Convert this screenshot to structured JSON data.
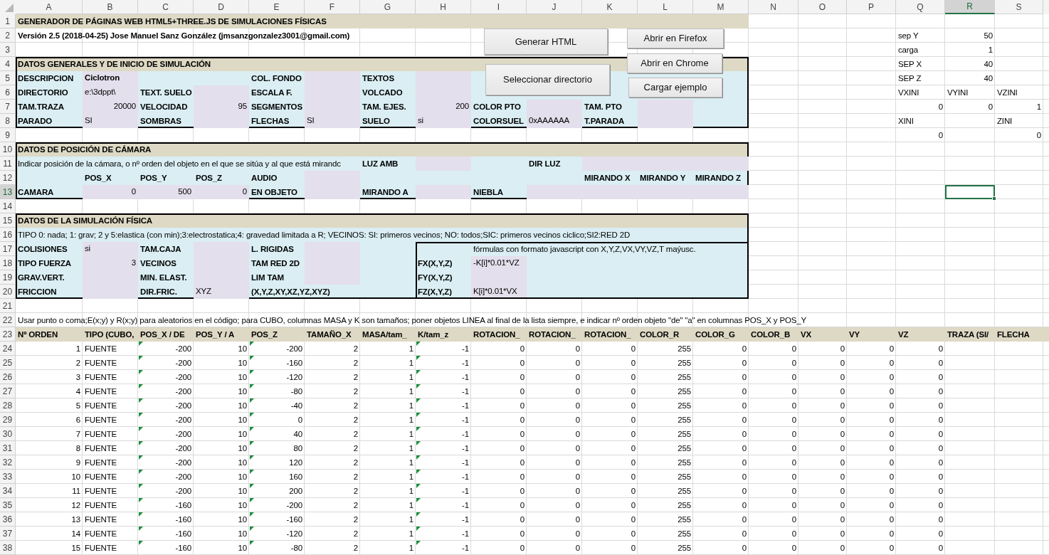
{
  "columns": [
    {
      "label": "A",
      "selected": false
    },
    {
      "label": "B",
      "selected": false
    },
    {
      "label": "C",
      "selected": false
    },
    {
      "label": "D",
      "selected": false
    },
    {
      "label": "E",
      "selected": false
    },
    {
      "label": "F",
      "selected": false
    },
    {
      "label": "G",
      "selected": false
    },
    {
      "label": "H",
      "selected": false
    },
    {
      "label": "I",
      "selected": false
    },
    {
      "label": "J",
      "selected": false
    },
    {
      "label": "K",
      "selected": false
    },
    {
      "label": "L",
      "selected": false
    },
    {
      "label": "M",
      "selected": false
    },
    {
      "label": "N",
      "selected": false
    },
    {
      "label": "O",
      "selected": false
    },
    {
      "label": "P",
      "selected": false
    },
    {
      "label": "Q",
      "selected": false
    },
    {
      "label": "R",
      "selected": true
    },
    {
      "label": "S",
      "selected": false
    }
  ],
  "buttons": [
    "Generar HTML",
    "Abrir en Firefox",
    "Abrir en Chrome",
    "Seleccionar directorio",
    "Cargar ejemplo"
  ],
  "rows": [
    {
      "n": "1",
      "kind": "heading",
      "selected": false,
      "cells": [
        {
          "text": "GENERADOR DE PÁGINAS WEB HTML5+THREE.JS DE SIMULACIONES FÍSICAS",
          "kind": "title",
          "input": false
        }
      ]
    },
    {
      "n": "2",
      "kind": "plain",
      "selected": false,
      "cells": [
        {
          "text": "Versión 2.5 (2018-04-25) Jose Manuel Sanz González (jmsanzgonzalez3001@gmail.com)",
          "kind": "label",
          "input": false
        },
        null,
        null,
        null,
        null,
        null,
        null,
        null,
        null,
        null,
        null,
        null,
        null,
        null,
        null,
        null,
        {
          "text": "sep Y",
          "kind": "text",
          "input": false
        },
        {
          "text": "50",
          "kind": "number",
          "input": false
        }
      ]
    },
    {
      "n": "3",
      "kind": "plain",
      "selected": false,
      "cells": [
        null,
        null,
        null,
        null,
        null,
        null,
        null,
        null,
        null,
        null,
        null,
        null,
        null,
        null,
        null,
        null,
        {
          "text": "carga",
          "kind": "text",
          "input": false
        },
        {
          "text": "1",
          "kind": "number",
          "input": false
        }
      ]
    },
    {
      "n": "4",
      "kind": "section",
      "selected": false,
      "cells": [
        {
          "text": "DATOS GENERALES Y DE INICIO DE SIMULACIÓN",
          "kind": "title",
          "input": false
        },
        null,
        null,
        null,
        null,
        null,
        null,
        null,
        null,
        null,
        null,
        null,
        null,
        null,
        null,
        null,
        {
          "text": "SEP X",
          "kind": "text",
          "input": false
        },
        {
          "text": "40",
          "kind": "number",
          "input": false
        }
      ]
    },
    {
      "n": "5",
      "kind": "panel",
      "selected": false,
      "cells": [
        {
          "text": "DESCRIPCION",
          "kind": "label",
          "input": false
        },
        {
          "text": "Ciclotron",
          "kind": "label",
          "input": true
        },
        null,
        null,
        {
          "text": "COL. FONDO",
          "kind": "label",
          "input": false
        },
        {
          "kind": "blank",
          "input": true
        },
        {
          "text": "TEXTOS",
          "kind": "label",
          "input": false
        },
        {
          "kind": "blank",
          "input": true
        },
        null,
        null,
        null,
        null,
        null,
        null,
        null,
        null,
        {
          "text": "SEP Z",
          "kind": "text",
          "input": false
        },
        {
          "text": "40",
          "kind": "number",
          "input": false
        }
      ]
    },
    {
      "n": "6",
      "kind": "panel",
      "selected": false,
      "cells": [
        {
          "text": "DIRECTORIO",
          "kind": "label",
          "input": false
        },
        {
          "text": "e:\\3dppt\\",
          "kind": "text",
          "input": true
        },
        {
          "text": "TEXT. SUELO",
          "kind": "label",
          "input": false
        },
        {
          "kind": "blank",
          "input": true
        },
        {
          "text": "ESCALA F.",
          "kind": "label",
          "input": false
        },
        {
          "kind": "blank",
          "input": true
        },
        {
          "text": "VOLCADO",
          "kind": "label",
          "input": false
        },
        {
          "kind": "blank",
          "input": true
        },
        null,
        null,
        null,
        null,
        null,
        null,
        null,
        null,
        {
          "text": "VXINI",
          "kind": "text",
          "input": false
        },
        {
          "text": "VYINI",
          "kind": "text",
          "input": false
        },
        {
          "text": "VZINI",
          "kind": "text",
          "input": false
        }
      ]
    },
    {
      "n": "7",
      "kind": "panel",
      "selected": false,
      "cells": [
        {
          "text": "TAM.TRAZA",
          "kind": "label",
          "input": false
        },
        {
          "text": "20000",
          "kind": "number",
          "input": true
        },
        {
          "text": "VELOCIDAD",
          "kind": "label",
          "input": false
        },
        {
          "text": "95",
          "kind": "number",
          "input": true
        },
        {
          "text": "SEGMENTOS",
          "kind": "label",
          "input": false
        },
        {
          "kind": "blank",
          "input": true
        },
        {
          "text": "TAM. EJES.",
          "kind": "label",
          "input": false
        },
        {
          "text": "200",
          "kind": "number",
          "input": true
        },
        {
          "text": "COLOR PTO",
          "kind": "label",
          "input": false
        },
        {
          "kind": "blank",
          "input": true
        },
        {
          "text": "TAM. PTO",
          "kind": "label",
          "input": false
        },
        {
          "kind": "blank",
          "input": true
        },
        null,
        null,
        null,
        null,
        {
          "text": "0",
          "kind": "number",
          "input": false
        },
        {
          "text": "0",
          "kind": "number",
          "input": false
        },
        {
          "text": "1",
          "kind": "number",
          "input": false
        }
      ]
    },
    {
      "n": "8",
      "kind": "panel",
      "selected": false,
      "cells": [
        {
          "text": "PARADO",
          "kind": "label",
          "input": false
        },
        {
          "text": "SI",
          "kind": "text",
          "input": true
        },
        {
          "text": "SOMBRAS",
          "kind": "label",
          "input": false
        },
        {
          "kind": "blank",
          "input": true
        },
        {
          "text": "FLECHAS",
          "kind": "label",
          "input": false
        },
        {
          "text": "SI",
          "kind": "text",
          "input": true
        },
        {
          "text": "SUELO",
          "kind": "label",
          "input": false
        },
        {
          "text": "si",
          "kind": "text",
          "input": true
        },
        {
          "text": "COLORSUEL",
          "kind": "label",
          "input": false
        },
        {
          "text": "0xAAAAAA",
          "kind": "text",
          "input": true
        },
        {
          "text": "T.PARADA",
          "kind": "label",
          "input": false
        },
        {
          "kind": "blank",
          "input": true
        },
        null,
        null,
        null,
        null,
        {
          "text": "XINI",
          "kind": "text",
          "input": false
        },
        null,
        {
          "text": "ZINI",
          "kind": "text",
          "input": false
        }
      ]
    },
    {
      "n": "9",
      "kind": "plain",
      "selected": false,
      "cells": [
        null,
        null,
        null,
        null,
        null,
        null,
        null,
        null,
        null,
        null,
        null,
        null,
        null,
        null,
        null,
        null,
        {
          "text": "0",
          "kind": "number",
          "input": false
        },
        null,
        {
          "text": "0",
          "kind": "number",
          "input": false
        }
      ]
    },
    {
      "n": "10",
      "kind": "section",
      "selected": false,
      "cells": [
        {
          "text": "DATOS DE POSICIÓN DE CÁMARA",
          "kind": "title",
          "input": false
        }
      ]
    },
    {
      "n": "11",
      "kind": "panel",
      "selected": false,
      "cells": [
        {
          "text": "Indicar posición de la cámara, o nº orden del objeto en el que se sitúa y al que está mirandc",
          "kind": "text",
          "input": false
        },
        null,
        null,
        null,
        null,
        null,
        {
          "text": "LUZ AMB",
          "kind": "label",
          "input": false
        },
        {
          "kind": "blank",
          "input": true
        },
        null,
        {
          "text": "DIR LUZ",
          "kind": "label",
          "input": false
        },
        {
          "kind": "blank",
          "input": true
        },
        {
          "kind": "blank",
          "input": true
        },
        {
          "kind": "blank",
          "input": true
        }
      ]
    },
    {
      "n": "12",
      "kind": "panel",
      "selected": false,
      "cells": [
        null,
        {
          "text": "POS_X",
          "kind": "label",
          "input": false
        },
        {
          "text": "POS_Y",
          "kind": "label",
          "input": false
        },
        {
          "text": "POS_Z",
          "kind": "label",
          "input": false
        },
        {
          "text": "AUDIO",
          "kind": "label",
          "input": false
        },
        {
          "kind": "blank",
          "input": true
        },
        null,
        null,
        null,
        null,
        {
          "text": "MIRANDO X",
          "kind": "label",
          "input": false
        },
        {
          "text": "MIRANDO Y",
          "kind": "label",
          "input": false
        },
        {
          "text": "MIRANDO Z",
          "kind": "label",
          "input": false
        }
      ]
    },
    {
      "n": "13",
      "kind": "panel",
      "selected": true,
      "cells": [
        {
          "text": "CAMARA",
          "kind": "label",
          "input": false
        },
        {
          "text": "0",
          "kind": "number",
          "input": true
        },
        {
          "text": "500",
          "kind": "number",
          "input": true
        },
        {
          "text": "0",
          "kind": "number",
          "input": true
        },
        {
          "text": "EN OBJETO",
          "kind": "label",
          "input": false
        },
        {
          "kind": "blank",
          "input": true
        },
        {
          "text": "MIRANDO A",
          "kind": "label",
          "input": false
        },
        {
          "kind": "blank",
          "input": true
        },
        {
          "text": "NIEBLA",
          "kind": "label",
          "input": false
        },
        {
          "kind": "blank",
          "input": true
        },
        {
          "kind": "blank",
          "input": true
        },
        {
          "kind": "blank",
          "input": true
        },
        {
          "kind": "blank",
          "input": true
        }
      ]
    },
    {
      "n": "14",
      "kind": "plain",
      "selected": false
    },
    {
      "n": "15",
      "kind": "section",
      "selected": false,
      "cells": [
        {
          "text": "DATOS DE LA SIMULACIÓN FÍSICA",
          "kind": "title",
          "input": false
        }
      ]
    },
    {
      "n": "16",
      "kind": "panel",
      "selected": false,
      "cells": [
        {
          "text": "TIPO 0: nada; 1: grav; 2 y 5:elastica (con min);3:electrostatica;4: gravedad limitada a R; VECINOS: SI: primeros vecinos; NO: todos;SIC: primeros vecinos ciclico;SI2:RED 2D",
          "kind": "text",
          "input": false
        }
      ]
    },
    {
      "n": "17",
      "kind": "panel",
      "selected": false,
      "formula_box": true,
      "cells": [
        {
          "text": "COLISIONES",
          "kind": "label",
          "input": false
        },
        {
          "text": "si",
          "kind": "text",
          "input": true
        },
        {
          "text": "TAM.CAJA",
          "kind": "label",
          "input": false
        },
        {
          "kind": "blank",
          "input": true
        },
        {
          "text": "L. RIGIDAS",
          "kind": "label",
          "input": false
        },
        {
          "kind": "blank",
          "input": true
        },
        null,
        null,
        {
          "text": "fórmulas con formato javascript con X,Y,Z,VX,VY,VZ,T maýusc.",
          "kind": "text",
          "input": false
        }
      ]
    },
    {
      "n": "18",
      "kind": "panel",
      "selected": false,
      "formula_box": true,
      "cells": [
        {
          "text": "TIPO FUERZA",
          "kind": "label",
          "input": false
        },
        {
          "text": "3",
          "kind": "number",
          "input": true
        },
        {
          "text": "VECINOS",
          "kind": "label",
          "input": false
        },
        {
          "kind": "blank",
          "input": true
        },
        {
          "text": "TAM RED 2D",
          "kind": "label",
          "input": false
        },
        {
          "kind": "blank",
          "input": true
        },
        null,
        {
          "text": "FX(X,Y,Z)",
          "kind": "label",
          "input": false
        },
        {
          "text": "-K[i]*0.01*VZ",
          "kind": "text",
          "input": true
        }
      ]
    },
    {
      "n": "19",
      "kind": "panel",
      "selected": false,
      "formula_box": true,
      "cells": [
        {
          "text": "GRAV.VERT.",
          "kind": "label",
          "input": false
        },
        {
          "kind": "blank",
          "input": true
        },
        {
          "text": "MIN. ELAST.",
          "kind": "label",
          "input": false
        },
        {
          "kind": "blank",
          "input": true
        },
        {
          "text": "LIM TAM",
          "kind": "label",
          "input": false
        },
        {
          "kind": "blank",
          "input": true
        },
        null,
        {
          "text": "FY(X,Y,Z)",
          "kind": "label",
          "input": false
        },
        {
          "kind": "blank",
          "input": true
        }
      ]
    },
    {
      "n": "20",
      "kind": "panel",
      "selected": false,
      "formula_box": true,
      "cells": [
        {
          "text": "FRICCION",
          "kind": "label",
          "input": false
        },
        {
          "kind": "blank",
          "input": true
        },
        {
          "text": "DIR.FRIC.",
          "kind": "label",
          "input": false
        },
        {
          "text": "XYZ",
          "kind": "text",
          "input": true
        },
        {
          "text": "(X,Y,Z,XY,XZ,YZ,XYZ)",
          "kind": "label",
          "input": false
        },
        null,
        null,
        {
          "text": "FZ(X,Y,Z)",
          "kind": "label",
          "input": false
        },
        {
          "text": "K[i]*0.01*VX",
          "kind": "text",
          "input": true
        }
      ]
    },
    {
      "n": "21",
      "kind": "plain",
      "selected": false
    },
    {
      "n": "22",
      "kind": "plain",
      "selected": false,
      "cells": [
        {
          "text": "Usar punto o coma;E(x;y) y R(x;y) para aleatorios en el código; para CUBO, columnas MASA y K son tamaños; poner objetos LINEA al final de la lista siempre, e indicar nº orden objeto \"de\" \"a\" en columnas POS_X y POS_Y",
          "kind": "text",
          "input": false
        }
      ]
    }
  ],
  "table": {
    "n": "23",
    "selected": false,
    "columns": [
      {
        "label": "Nº ORDEN",
        "kind": "number"
      },
      {
        "label": "TIPO (CUBO,",
        "kind": "text"
      },
      {
        "label": "POS_X / DE",
        "kind": "number"
      },
      {
        "label": "POS_Y / A",
        "kind": "number"
      },
      {
        "label": "POS_Z",
        "kind": "number"
      },
      {
        "label": "TAMAÑO_X",
        "kind": "number"
      },
      {
        "label": "MASA/tam_",
        "kind": "number"
      },
      {
        "label": "K/tam_z",
        "kind": "number"
      },
      {
        "label": "ROTACION_",
        "kind": "number"
      },
      {
        "label": "ROTACION_",
        "kind": "number"
      },
      {
        "label": "ROTACION_",
        "kind": "number"
      },
      {
        "label": "COLOR_R",
        "kind": "number"
      },
      {
        "label": "COLOR_G",
        "kind": "number"
      },
      {
        "label": "COLOR_B",
        "kind": "number"
      },
      {
        "label": "VX",
        "kind": "number"
      },
      {
        "label": "VY",
        "kind": "number"
      },
      {
        "label": "VZ",
        "kind": "number"
      },
      {
        "label": "TRAZA (SI/",
        "kind": "text"
      },
      {
        "label": "FLECHA",
        "kind": "text"
      }
    ],
    "rows": [
      {
        "n": "24",
        "selected": false,
        "values": [
          "1",
          "FUENTE",
          "-200",
          "10",
          "-200",
          "2",
          "1",
          "-1",
          "0",
          "0",
          "0",
          "255",
          "0",
          "0",
          "0",
          "0",
          "0"
        ],
        "warn": [
          false,
          false,
          true,
          false,
          true,
          false,
          false,
          true,
          false,
          false,
          false,
          false,
          false,
          false,
          false,
          false,
          false
        ]
      },
      {
        "n": "25",
        "selected": false,
        "values": [
          "2",
          "FUENTE",
          "-200",
          "10",
          "-160",
          "2",
          "1",
          "-1",
          "0",
          "0",
          "0",
          "255",
          "0",
          "0",
          "0",
          "0",
          "0"
        ],
        "warn": [
          false,
          false,
          true,
          false,
          true,
          false,
          false,
          true,
          false,
          false,
          false,
          false,
          false,
          false,
          false,
          false,
          false
        ]
      },
      {
        "n": "26",
        "selected": false,
        "values": [
          "3",
          "FUENTE",
          "-200",
          "10",
          "-120",
          "2",
          "1",
          "-1",
          "0",
          "0",
          "0",
          "255",
          "0",
          "0",
          "0",
          "0",
          "0"
        ],
        "warn": [
          false,
          false,
          true,
          false,
          true,
          false,
          false,
          true,
          false,
          false,
          false,
          false,
          false,
          false,
          false,
          false,
          false
        ]
      },
      {
        "n": "27",
        "selected": false,
        "values": [
          "4",
          "FUENTE",
          "-200",
          "10",
          "-80",
          "2",
          "1",
          "-1",
          "0",
          "0",
          "0",
          "255",
          "0",
          "0",
          "0",
          "0",
          "0"
        ],
        "warn": [
          false,
          false,
          true,
          false,
          true,
          false,
          false,
          true,
          false,
          false,
          false,
          false,
          false,
          false,
          false,
          false,
          false
        ]
      },
      {
        "n": "28",
        "selected": false,
        "values": [
          "5",
          "FUENTE",
          "-200",
          "10",
          "-40",
          "2",
          "1",
          "-1",
          "0",
          "0",
          "0",
          "255",
          "0",
          "0",
          "0",
          "0",
          "0"
        ],
        "warn": [
          false,
          false,
          true,
          false,
          true,
          false,
          false,
          true,
          false,
          false,
          false,
          false,
          false,
          false,
          false,
          false,
          false
        ]
      },
      {
        "n": "29",
        "selected": false,
        "values": [
          "6",
          "FUENTE",
          "-200",
          "10",
          "0",
          "2",
          "1",
          "-1",
          "0",
          "0",
          "0",
          "255",
          "0",
          "0",
          "0",
          "0",
          "0"
        ],
        "warn": [
          false,
          false,
          true,
          false,
          true,
          false,
          false,
          true,
          false,
          false,
          false,
          false,
          false,
          false,
          false,
          false,
          false
        ]
      },
      {
        "n": "30",
        "selected": false,
        "values": [
          "7",
          "FUENTE",
          "-200",
          "10",
          "40",
          "2",
          "1",
          "-1",
          "0",
          "0",
          "0",
          "255",
          "0",
          "0",
          "0",
          "0",
          "0"
        ],
        "warn": [
          false,
          false,
          true,
          false,
          true,
          false,
          false,
          true,
          false,
          false,
          false,
          false,
          false,
          false,
          false,
          false,
          false
        ]
      },
      {
        "n": "31",
        "selected": false,
        "values": [
          "8",
          "FUENTE",
          "-200",
          "10",
          "80",
          "2",
          "1",
          "-1",
          "0",
          "0",
          "0",
          "255",
          "0",
          "0",
          "0",
          "0",
          "0"
        ],
        "warn": [
          false,
          false,
          true,
          false,
          true,
          false,
          false,
          true,
          false,
          false,
          false,
          false,
          false,
          false,
          false,
          false,
          false
        ]
      },
      {
        "n": "32",
        "selected": false,
        "values": [
          "9",
          "FUENTE",
          "-200",
          "10",
          "120",
          "2",
          "1",
          "-1",
          "0",
          "0",
          "0",
          "255",
          "0",
          "0",
          "0",
          "0",
          "0"
        ],
        "warn": [
          false,
          false,
          true,
          false,
          true,
          false,
          false,
          true,
          false,
          false,
          false,
          false,
          false,
          false,
          false,
          false,
          false
        ]
      },
      {
        "n": "33",
        "selected": false,
        "values": [
          "10",
          "FUENTE",
          "-200",
          "10",
          "160",
          "2",
          "1",
          "-1",
          "0",
          "0",
          "0",
          "255",
          "0",
          "0",
          "0",
          "0",
          "0"
        ],
        "warn": [
          false,
          false,
          true,
          false,
          true,
          false,
          false,
          true,
          false,
          false,
          false,
          false,
          false,
          false,
          false,
          false,
          false
        ]
      },
      {
        "n": "34",
        "selected": false,
        "values": [
          "11",
          "FUENTE",
          "-200",
          "10",
          "200",
          "2",
          "1",
          "-1",
          "0",
          "0",
          "0",
          "255",
          "0",
          "0",
          "0",
          "0",
          "0"
        ],
        "warn": [
          false,
          false,
          true,
          false,
          true,
          false,
          false,
          true,
          false,
          false,
          false,
          false,
          false,
          false,
          false,
          false,
          false
        ]
      },
      {
        "n": "35",
        "selected": false,
        "values": [
          "12",
          "FUENTE",
          "-160",
          "10",
          "-200",
          "2",
          "1",
          "-1",
          "0",
          "0",
          "0",
          "255",
          "0",
          "0",
          "0",
          "0",
          "0"
        ],
        "warn": [
          false,
          false,
          true,
          false,
          true,
          false,
          false,
          true,
          false,
          false,
          false,
          false,
          false,
          false,
          false,
          false,
          false
        ]
      },
      {
        "n": "36",
        "selected": false,
        "values": [
          "13",
          "FUENTE",
          "-160",
          "10",
          "-160",
          "2",
          "1",
          "-1",
          "0",
          "0",
          "0",
          "255",
          "0",
          "0",
          "0",
          "0",
          "0"
        ],
        "warn": [
          false,
          false,
          true,
          false,
          true,
          false,
          false,
          true,
          false,
          false,
          false,
          false,
          false,
          false,
          false,
          false,
          false
        ]
      },
      {
        "n": "37",
        "selected": false,
        "values": [
          "14",
          "FUENTE",
          "-160",
          "10",
          "-120",
          "2",
          "1",
          "-1",
          "0",
          "0",
          "0",
          "255",
          "0",
          "0",
          "0",
          "0",
          "0"
        ],
        "warn": [
          false,
          false,
          true,
          false,
          true,
          false,
          false,
          true,
          false,
          false,
          false,
          false,
          false,
          false,
          false,
          false,
          false
        ]
      },
      {
        "n": "38",
        "selected": false,
        "values": [
          "15",
          "FUENTE",
          "-160",
          "10",
          "-80",
          "2",
          "1",
          "-1",
          "0",
          "0",
          "0",
          "255",
          "0",
          "0",
          "0",
          "0",
          "0"
        ],
        "warn": [
          false,
          false,
          true,
          false,
          true,
          false,
          false,
          true,
          false,
          false,
          false,
          false,
          false,
          false,
          false,
          false,
          false
        ]
      }
    ]
  }
}
